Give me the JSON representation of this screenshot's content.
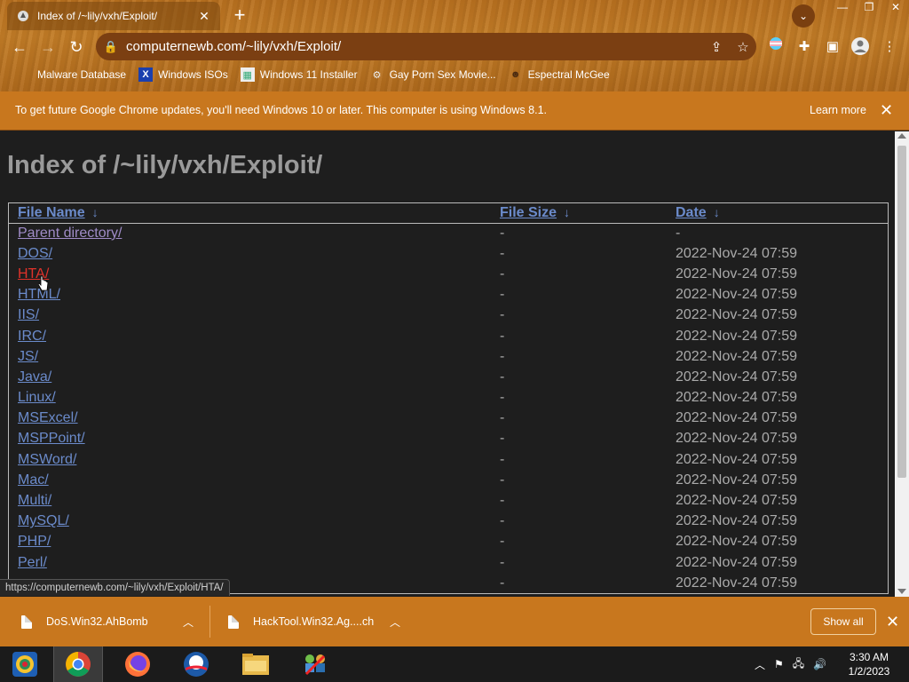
{
  "browser": {
    "tab_title": "Index of /~lily/vxh/Exploit/",
    "url": "computernewb.com/~lily/vxh/Exploit/",
    "bookmarks": [
      {
        "label": "Malware Database",
        "icon": "blank-icon"
      },
      {
        "label": "Windows ISOs",
        "icon": "x-logo-icon"
      },
      {
        "label": "Windows 11 Installer",
        "icon": "image-icon"
      },
      {
        "label": "Gay Porn Sex Movie...",
        "icon": "gear-globe-icon"
      },
      {
        "label": "Espectral McGee",
        "icon": "avatar-icon"
      }
    ]
  },
  "infobar": {
    "message": "To get future Google Chrome updates, you'll need Windows 10 or later. This computer is using Windows 8.1.",
    "learn_more": "Learn more"
  },
  "page": {
    "title": "Index of /~lily/vxh/Exploit/",
    "headers": {
      "name": "File Name",
      "size": "File Size",
      "date": "Date",
      "sort_glyph": "↓"
    },
    "rows": [
      {
        "name": "Parent directory/",
        "size": "-",
        "date": "-",
        "state": "visited"
      },
      {
        "name": "DOS/",
        "size": "-",
        "date": "2022-Nov-24 07:59",
        "state": "normal"
      },
      {
        "name": "HTA/",
        "size": "-",
        "date": "2022-Nov-24 07:59",
        "state": "hover"
      },
      {
        "name": "HTML/",
        "size": "-",
        "date": "2022-Nov-24 07:59",
        "state": "normal"
      },
      {
        "name": "IIS/",
        "size": "-",
        "date": "2022-Nov-24 07:59",
        "state": "normal"
      },
      {
        "name": "IRC/",
        "size": "-",
        "date": "2022-Nov-24 07:59",
        "state": "normal"
      },
      {
        "name": "JS/",
        "size": "-",
        "date": "2022-Nov-24 07:59",
        "state": "normal"
      },
      {
        "name": "Java/",
        "size": "-",
        "date": "2022-Nov-24 07:59",
        "state": "normal"
      },
      {
        "name": "Linux/",
        "size": "-",
        "date": "2022-Nov-24 07:59",
        "state": "normal"
      },
      {
        "name": "MSExcel/",
        "size": "-",
        "date": "2022-Nov-24 07:59",
        "state": "normal"
      },
      {
        "name": "MSPPoint/",
        "size": "-",
        "date": "2022-Nov-24 07:59",
        "state": "normal"
      },
      {
        "name": "MSWord/",
        "size": "-",
        "date": "2022-Nov-24 07:59",
        "state": "normal"
      },
      {
        "name": "Mac/",
        "size": "-",
        "date": "2022-Nov-24 07:59",
        "state": "normal"
      },
      {
        "name": "Multi/",
        "size": "-",
        "date": "2022-Nov-24 07:59",
        "state": "normal"
      },
      {
        "name": "MySQL/",
        "size": "-",
        "date": "2022-Nov-24 07:59",
        "state": "normal"
      },
      {
        "name": "PHP/",
        "size": "-",
        "date": "2022-Nov-24 07:59",
        "state": "normal"
      },
      {
        "name": "Perl/",
        "size": "-",
        "date": "2022-Nov-24 07:59",
        "state": "normal"
      },
      {
        "name": "",
        "size": "-",
        "date": "2022-Nov-24 07:59",
        "state": "normal"
      }
    ]
  },
  "status_url": "https://computernewb.com/~lily/vxh/Exploit/HTA/",
  "downloads": {
    "items": [
      {
        "name": "DoS.Win32.AhBomb"
      },
      {
        "name": "HackTool.Win32.Ag....ch"
      }
    ],
    "show_all": "Show all"
  },
  "taskbar": {
    "time": "3:30 AM",
    "date": "1/2/2023"
  }
}
